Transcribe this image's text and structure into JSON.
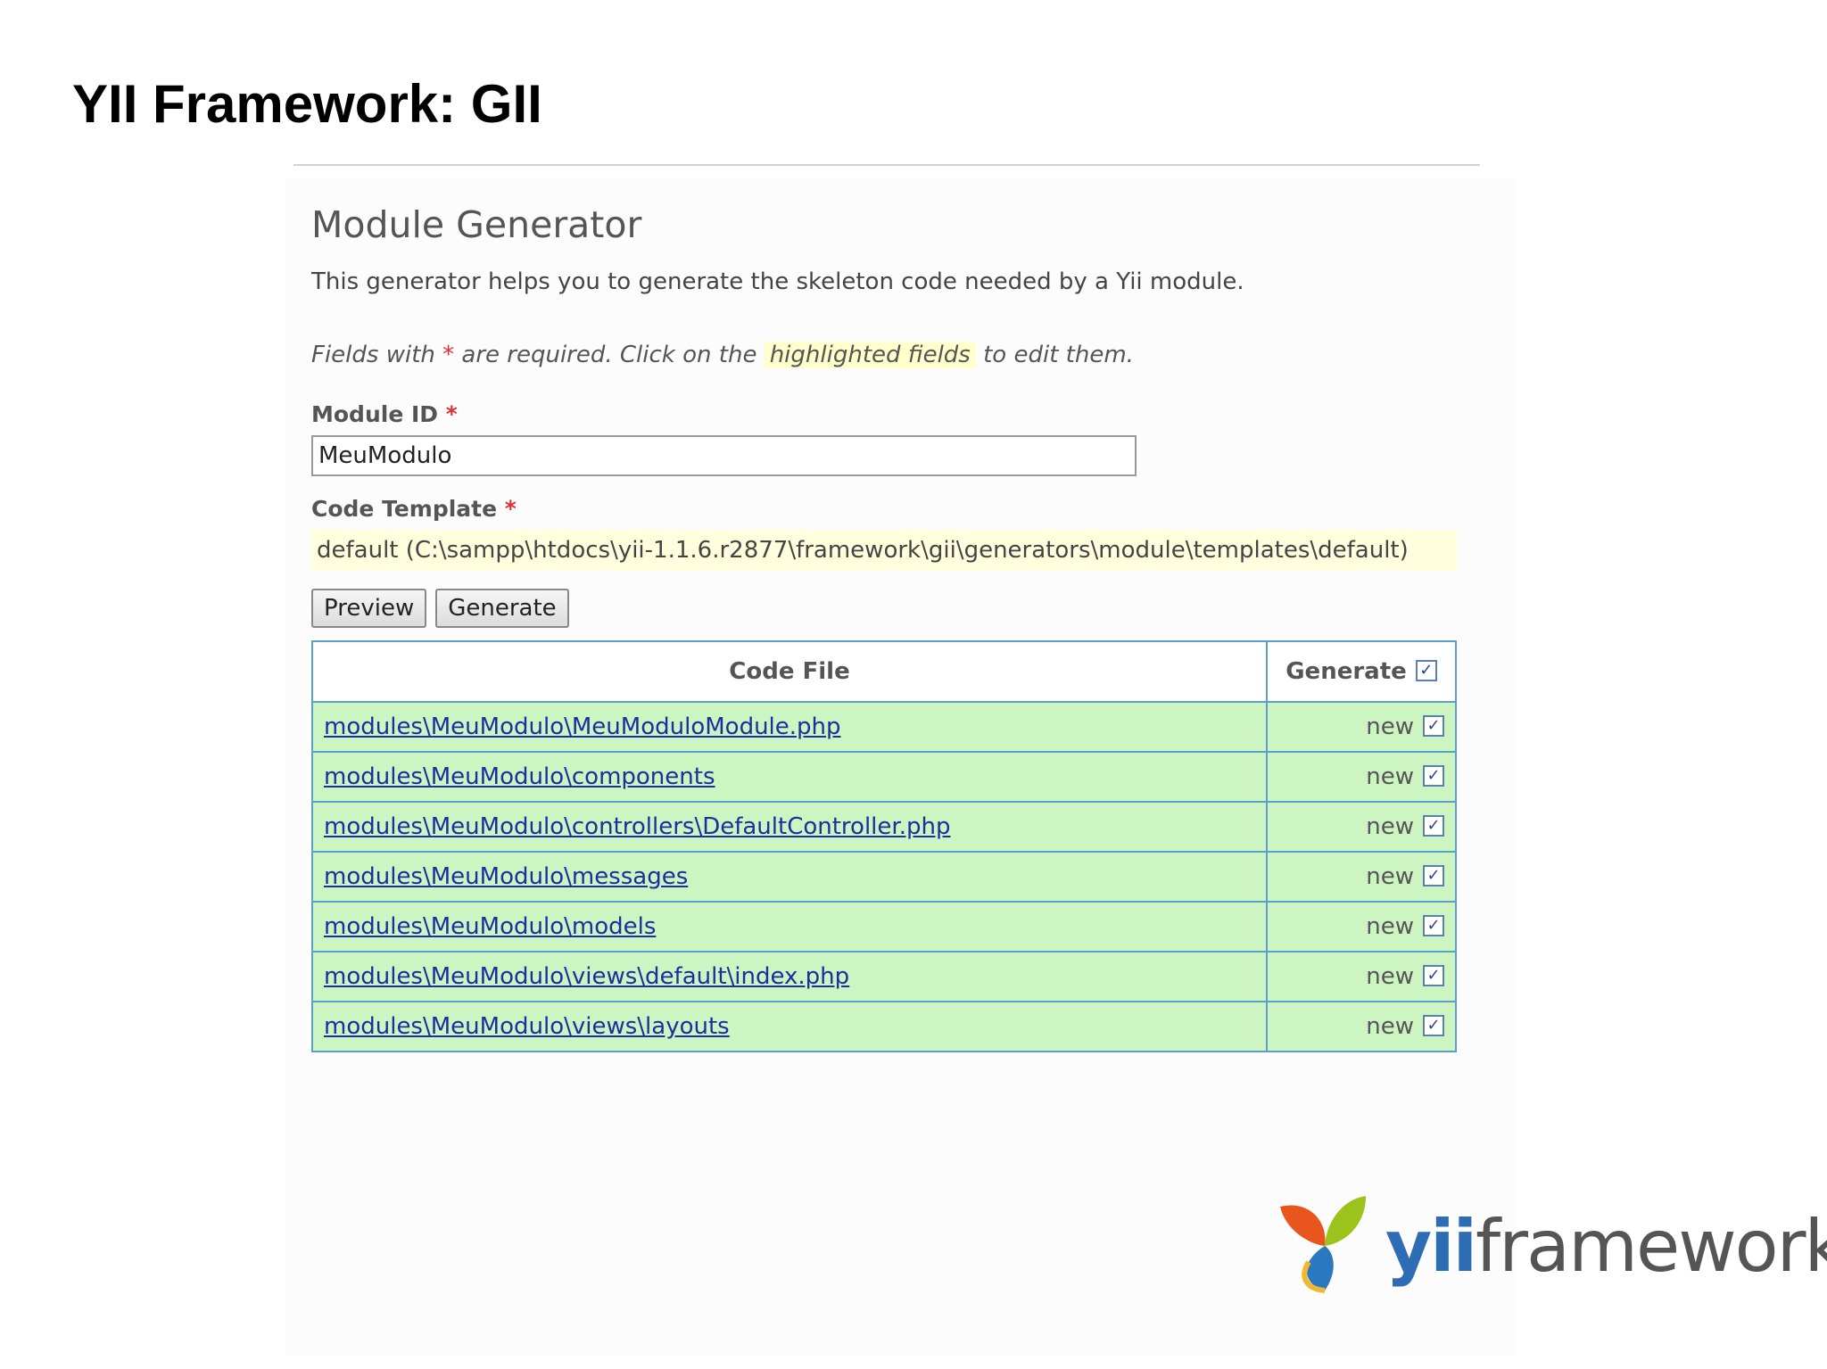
{
  "slide": {
    "title": "YII Framework: GII"
  },
  "generator": {
    "title": "Module Generator",
    "description": "This generator helps you to generate the skeleton code needed by a Yii module.",
    "hint_prefix": "Fields with ",
    "hint_star": "*",
    "hint_middle": " are required. Click on the ",
    "hint_highlight": "highlighted fields",
    "hint_suffix": " to edit them."
  },
  "form": {
    "module_id_label": "Module ID",
    "module_id_value": "MeuModulo",
    "code_template_label": "Code Template",
    "code_template_value": "default (C:\\sampp\\htdocs\\yii-1.1.6.r2877\\framework\\gii\\generators\\module\\templates\\default)",
    "required_mark": "*",
    "preview_label": "Preview",
    "generate_label": "Generate"
  },
  "table": {
    "headers": {
      "file": "Code File",
      "generate": "Generate"
    },
    "rows": [
      {
        "file": "modules\\MeuModulo\\MeuModuloModule.php",
        "status": "new"
      },
      {
        "file": "modules\\MeuModulo\\components",
        "status": "new"
      },
      {
        "file": "modules\\MeuModulo\\controllers\\DefaultController.php",
        "status": "new"
      },
      {
        "file": "modules\\MeuModulo\\messages",
        "status": "new"
      },
      {
        "file": "modules\\MeuModulo\\models",
        "status": "new"
      },
      {
        "file": "modules\\MeuModulo\\views\\default\\index.php",
        "status": "new"
      },
      {
        "file": "modules\\MeuModulo\\views\\layouts",
        "status": "new"
      }
    ]
  },
  "logo": {
    "part1": "yii",
    "part2": "framework",
    "icon": "yii-leaf-logo-icon"
  },
  "colors": {
    "row_bg": "#ccf5c2",
    "border": "#5a9fd0",
    "link": "#1a2fa0",
    "highlight": "#ffffcc",
    "required": "#e03030"
  }
}
